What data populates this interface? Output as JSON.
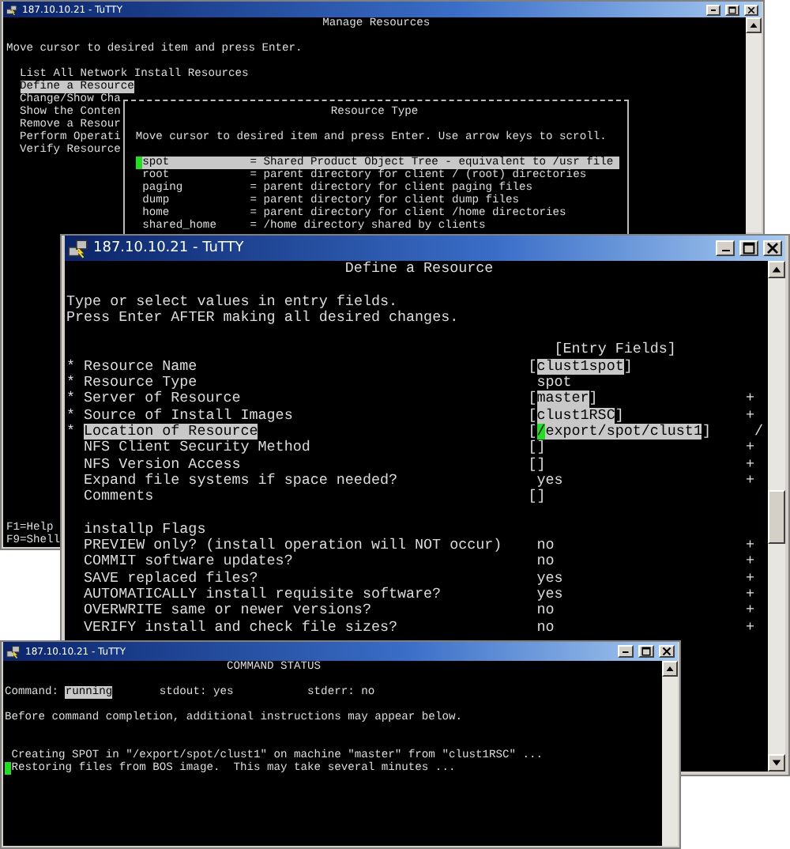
{
  "manage_window": {
    "title": "187.10.10.21 - TuTTY",
    "heading": "Manage Resources",
    "instruction": "Move cursor to desired item and press Enter.",
    "menu_items": [
      {
        "label": "List All Network Install Resources",
        "selected": false
      },
      {
        "label": "Define a Resource",
        "selected": true
      },
      {
        "label": "Change/Show Cha",
        "selected": false
      },
      {
        "label": "Show the Conten",
        "selected": false
      },
      {
        "label": "Remove a Resour",
        "selected": false
      },
      {
        "label": "Perform Operati",
        "selected": false
      },
      {
        "label": "Verify Resource",
        "selected": false
      }
    ],
    "popup": {
      "title": "Resource Type",
      "instruction": "Move cursor to desired item and press Enter. Use arrow keys to scroll.",
      "items": [
        {
          "name": "spot",
          "description": "= Shared Product Object Tree - equivalent to /usr file",
          "selected": true
        },
        {
          "name": "root",
          "description": "= parent directory for client / (root) directories",
          "selected": false
        },
        {
          "name": "paging",
          "description": "= parent directory for client paging files",
          "selected": false
        },
        {
          "name": "dump",
          "description": "= parent directory for client dump files",
          "selected": false
        },
        {
          "name": "home",
          "description": "= parent directory for client /home directories",
          "selected": false
        },
        {
          "name": "shared_home",
          "description": "= /home directory shared by clients",
          "selected": false
        }
      ]
    },
    "function_keys": [
      "F1=Help",
      "F9=Shell"
    ]
  },
  "define_window": {
    "title": "187.10.10.21 - TuTTY",
    "heading": "Define a Resource",
    "instructions": [
      "Type or select values in entry fields.",
      "Press Enter AFTER making all desired changes."
    ],
    "column_header": "[Entry Fields]",
    "fields": [
      {
        "mark": "*",
        "label": "Resource Name",
        "kind": "bracketed",
        "open": "[",
        "value": "clust1spot",
        "close": "]",
        "highlighted": true,
        "selected": false
      },
      {
        "mark": "*",
        "label": "Resource Type",
        "kind": "plain",
        "value": "spot",
        "selected": false
      },
      {
        "mark": "*",
        "label": "Server of Resource",
        "kind": "bracketed",
        "open": "[",
        "value": "master",
        "close": "]",
        "highlighted": true,
        "selected": false,
        "hint": {
          "kind": "list",
          "text": "+"
        }
      },
      {
        "mark": "*",
        "label": "Source of Install Images",
        "kind": "bracketed",
        "open": "[",
        "value": "clust1RSC",
        "close": "]",
        "highlighted": true,
        "selected": false,
        "hint": {
          "kind": "list",
          "text": "+"
        }
      },
      {
        "mark": "*",
        "label": "Location of Resource",
        "kind": "bracketed",
        "open": "[",
        "value": "/export/spot/clust1",
        "close": "]",
        "highlighted": true,
        "selected": true,
        "cursor": true,
        "hint": {
          "kind": "path",
          "text": "/"
        }
      },
      {
        "label": "NFS Client Security Method",
        "kind": "bracketed",
        "open": "[",
        "close": "]",
        "selected": false,
        "hint": {
          "kind": "list",
          "text": "+"
        }
      },
      {
        "label": "NFS Version Access",
        "kind": "bracketed",
        "open": "[",
        "close": "]",
        "selected": false,
        "hint": {
          "kind": "list",
          "text": "+"
        }
      },
      {
        "label": "Expand file systems if space needed?",
        "kind": "plain",
        "value": "yes",
        "selected": false,
        "hint": {
          "kind": "list",
          "text": "+"
        }
      },
      {
        "label": "Comments",
        "kind": "bracketed",
        "open": "[",
        "close": "]",
        "selected": false
      }
    ],
    "section": "installp Flags",
    "flags": [
      {
        "label": "PREVIEW only? (install operation will NOT occur)",
        "value": "no",
        "hint": "+"
      },
      {
        "label": "COMMIT software updates?",
        "value": "no",
        "hint": "+"
      },
      {
        "label": "SAVE replaced files?",
        "value": "yes",
        "hint": "+"
      },
      {
        "label": "AUTOMATICALLY install requisite software?",
        "value": "yes",
        "hint": "+"
      },
      {
        "label": "OVERWRITE same or newer versions?",
        "value": "no",
        "hint": "+"
      },
      {
        "label": "VERIFY install and check file sizes?",
        "value": "no",
        "hint": "+"
      }
    ]
  },
  "status_window": {
    "title": "187.10.10.21 - TuTTY",
    "heading": "COMMAND STATUS",
    "status": [
      {
        "label": "Command:",
        "value": "running",
        "highlighted": true
      },
      {
        "label": "stdout:",
        "value": "yes",
        "highlighted": false
      },
      {
        "label": "stderr:",
        "value": "no",
        "highlighted": false
      }
    ],
    "notice": "Before command completion, additional instructions may appear below.",
    "output": [
      {
        "text": "Creating SPOT in \"/export/spot/clust1\" on machine \"master\" from \"clust1RSC\" ..."
      },
      {
        "text": "Restoring files from BOS image.  This may take several minutes ...",
        "cursor": true
      }
    ]
  }
}
